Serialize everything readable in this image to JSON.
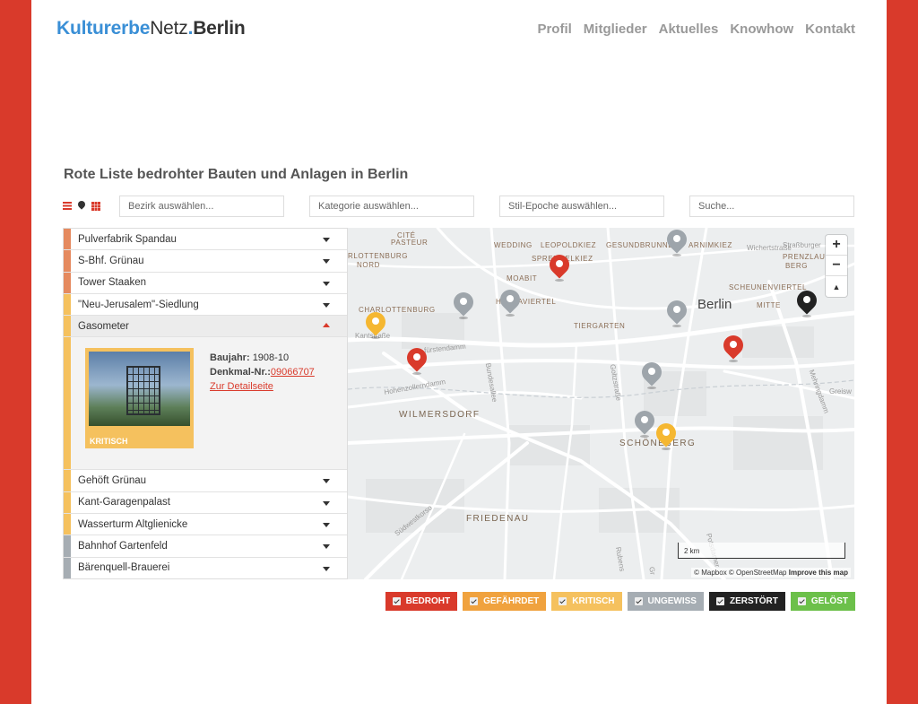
{
  "logo": {
    "part1": "Kulturerbe",
    "part2": "Netz",
    "part3": ".",
    "part4": "Berlin"
  },
  "nav": [
    "Profil",
    "Mitglieder",
    "Aktuelles",
    "Knowhow",
    "Kontakt"
  ],
  "page_title": "Rote Liste bedrohter Bauten und Anlagen in Berlin",
  "view_icons": [
    "list-icon",
    "map-pin-icon",
    "grid-icon"
  ],
  "filters": {
    "bezirk": "Bezirk auswählen...",
    "kategorie": "Kategorie auswählen...",
    "stil": "Stil-Epoche auswählen...",
    "suche": "Suche..."
  },
  "list_items": [
    {
      "name": "Pulverfabrik Spandau",
      "color": "#e58a5f"
    },
    {
      "name": "S-Bhf. Grünau",
      "color": "#e58a5f"
    },
    {
      "name": "Tower Staaken",
      "color": "#e58a5f"
    },
    {
      "name": "\"Neu-Jerusalem\"-Siedlung",
      "color": "#f5c15e"
    },
    {
      "name": "Gasometer",
      "color": "#f5c15e",
      "open": true
    },
    {
      "name": "Gehöft Grünau",
      "color": "#f5c15e"
    },
    {
      "name": "Kant-Garagenpalast",
      "color": "#f5c15e"
    },
    {
      "name": "Wasserturm Altglienicke",
      "color": "#f5c15e"
    },
    {
      "name": "Bahnhof Gartenfeld",
      "color": "#a6adb3"
    },
    {
      "name": "Bärenquell-Brauerei",
      "color": "#a6adb3"
    }
  ],
  "detail": {
    "status": "KRITISCH",
    "baujahr_label": "Baujahr:",
    "baujahr": "1908-10",
    "denkmal_label": "Denkmal-Nr.:",
    "denkmal_nr": "09066707",
    "link": "Zur Detailseite"
  },
  "map": {
    "labels": {
      "city": "Berlin",
      "charlottenburg": "CHARLOTTENBURG",
      "tiergarten": "TIERGARTEN",
      "wilmersdorf": "WILMERSDORF",
      "schoeneberg": "SCHÖNEBERG",
      "friedenau": "FRIEDENAU",
      "moabit": "MOABIT",
      "mitte": "MITTE",
      "scheunenviertel": "SCHEUNENVIERTEL",
      "hansaviertel": "HANSAVIERTEL",
      "wedding": "WEDDING",
      "leopoldkiez": "LEOPOLDKIEZ",
      "gesundbrunnen": "GESUNDBRUNNEN",
      "arnimkiez": "ARNIMKIEZ",
      "prenzlauer": "PRENZLAUER",
      "berg": "BERG",
      "cite": "CITÉ",
      "pasteur": "PASTEUR",
      "lottenburg": "RLOTTENBURG",
      "nord": "NORD",
      "sprengelkiez": "SPRENGELKIEZ",
      "kurfuerstendamm": "fürstendamm",
      "hohenzollerndamm": "Hohenzollerndamm",
      "suedwestkorso": "Südwestkorso",
      "kantstrasse": "Kantstraße",
      "bundesallee": "Bundesallee",
      "mehringdamm": "Mehringdamm",
      "greifswalder": "Greisw",
      "potsdamer": "Potsdamer",
      "rubens": "Rubens",
      "gr": "Gr",
      "wichertstrasse": "Wichertstraße",
      "strassburger": "Straßburger",
      "muellerstr": "Müllerstraße",
      "goltzstr": "Goltzstraße"
    },
    "zoom_in": "+",
    "zoom_out": "−",
    "reset": "▲",
    "scale": "2 km",
    "attribution": "© Mapbox © OpenStreetMap",
    "improve": "Improve this map"
  },
  "legend": [
    {
      "label": "BEDROHT",
      "color": "#d93a2b"
    },
    {
      "label": "GEFÄHRDET",
      "color": "#f0a23e"
    },
    {
      "label": "KRITISCH",
      "color": "#f5c15e"
    },
    {
      "label": "UNGEWISS",
      "color": "#a6adb3"
    },
    {
      "label": "ZERSTÖRT",
      "color": "#222222"
    },
    {
      "label": "GELÖST",
      "color": "#6cc04a"
    }
  ]
}
